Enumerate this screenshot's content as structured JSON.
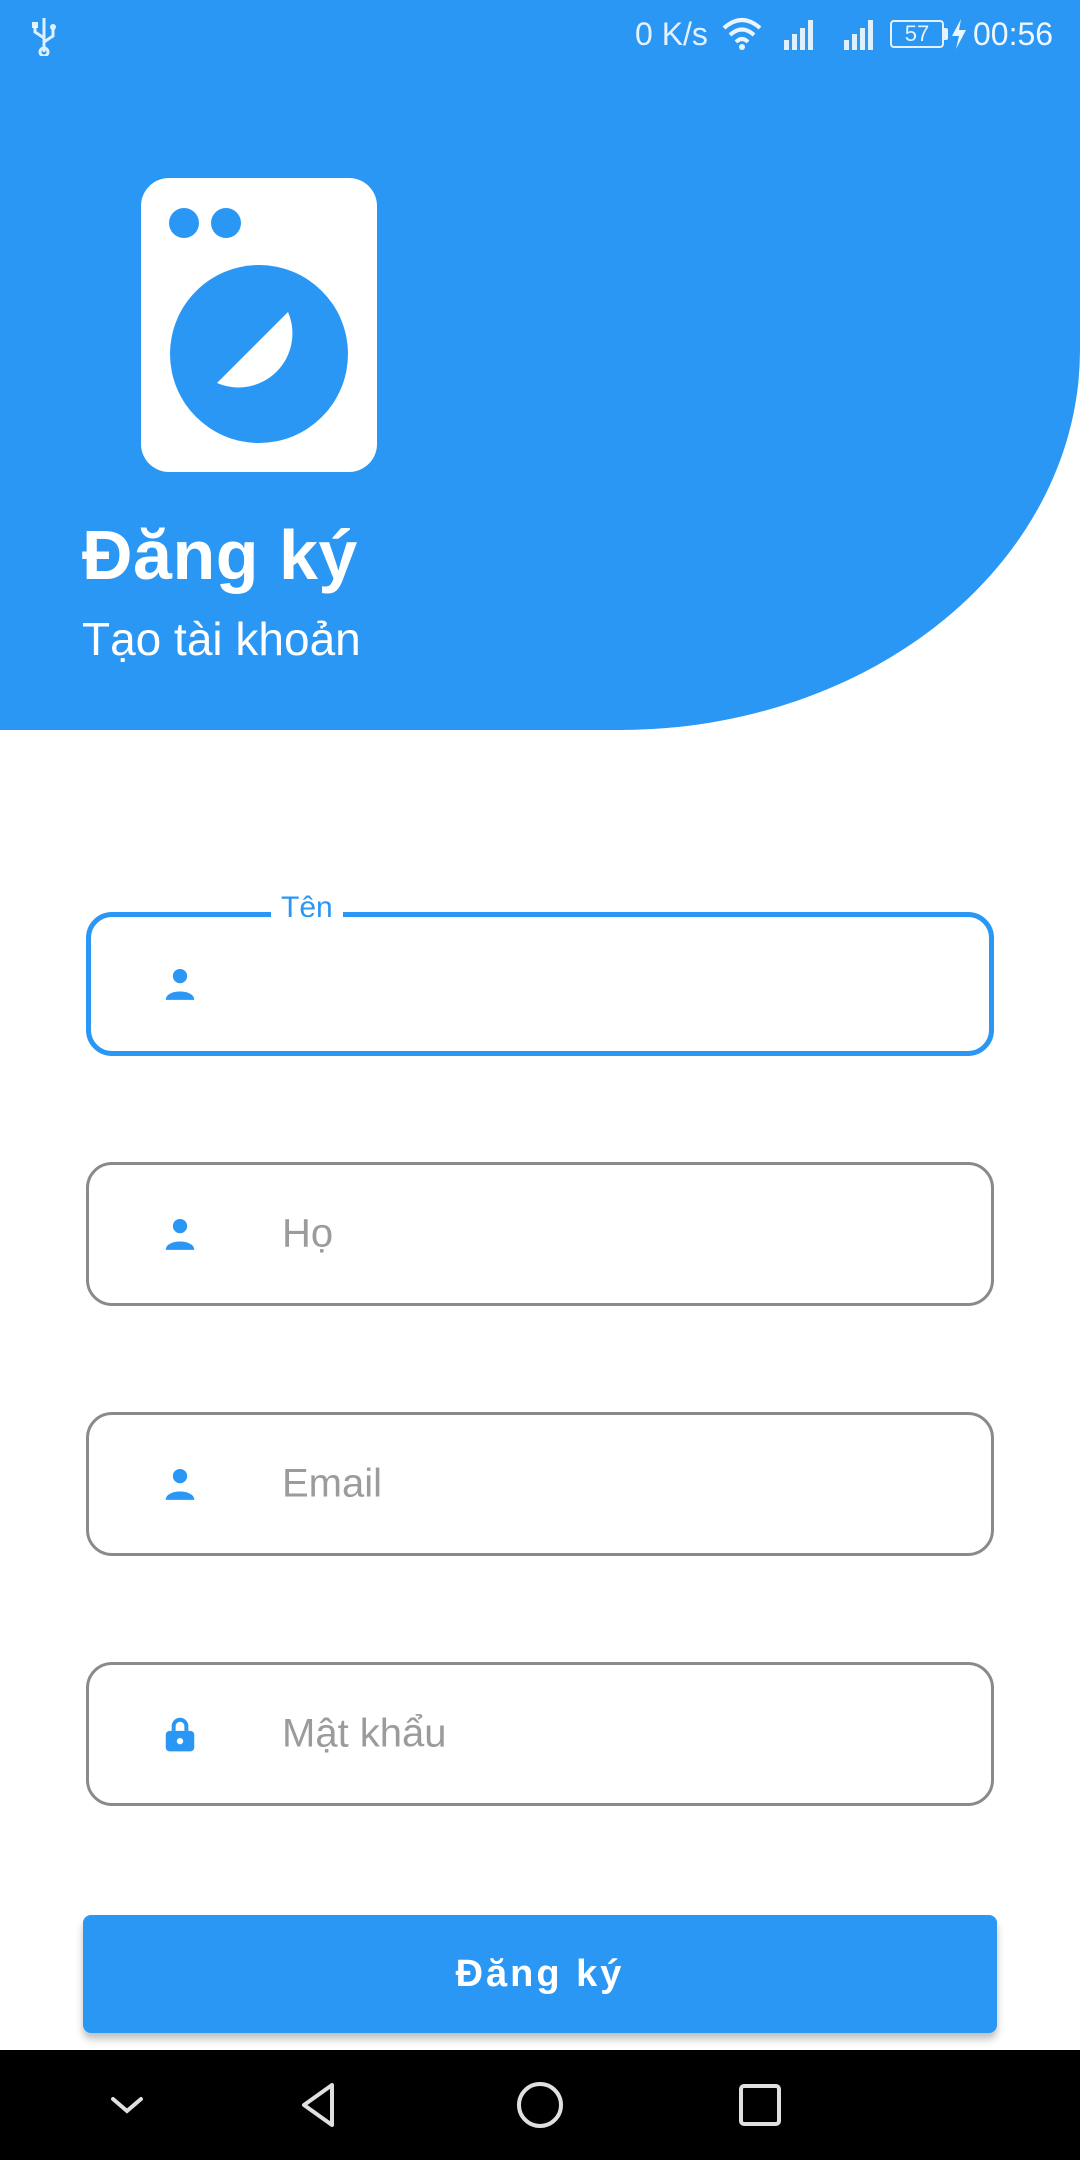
{
  "status_bar": {
    "net_speed": "0 K/s",
    "battery": "57",
    "time": "00:56"
  },
  "header": {
    "title": "Đăng ký",
    "subtitle": "Tạo tài khoản"
  },
  "form": {
    "first_name_label": "Tên",
    "last_name_placeholder": "Họ",
    "email_placeholder": "Email",
    "password_placeholder": "Mật khẩu",
    "submit_label": "Đăng ký"
  },
  "colors": {
    "accent": "#2a97f5",
    "border": "#8a8a8a",
    "placeholder": "#9b9b9b"
  },
  "icons": [
    "usb-icon",
    "wifi-icon",
    "signal-icon",
    "battery-icon",
    "charging-icon",
    "washing-machine-logo",
    "person-icon",
    "lock-icon",
    "chevron-down-icon",
    "back-icon",
    "home-icon",
    "recents-icon"
  ]
}
